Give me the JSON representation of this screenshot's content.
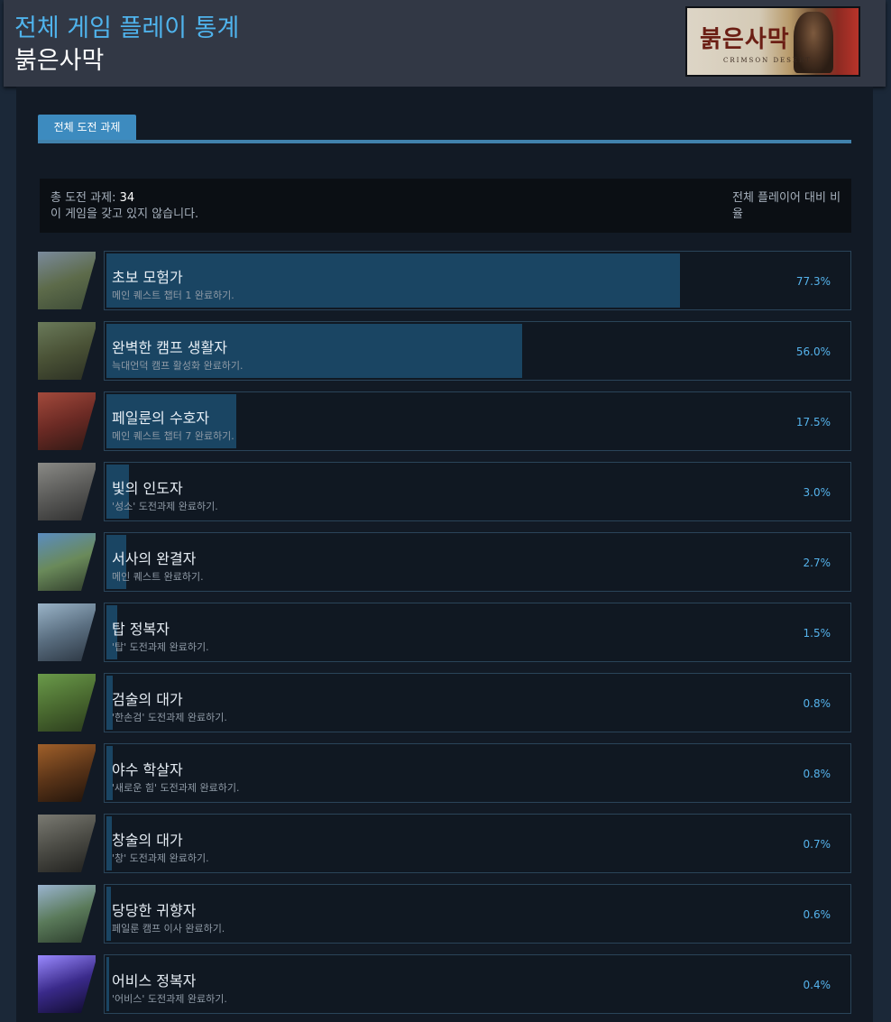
{
  "header": {
    "title": "전체 게임 플레이 통계",
    "game_name": "붉은사막",
    "capsule": {
      "title": "붉은사막",
      "subtitle": "CRIMSON DESERT"
    }
  },
  "tabs": [
    {
      "label": "전체 도전 과제",
      "active": true
    }
  ],
  "summary": {
    "total_label": "총 도전 과제: ",
    "total_count": "34",
    "ownership_note": "이 게임을 갖고 있지 않습니다.",
    "column_header": "전체 플레이어 대비 비율"
  },
  "colors": {
    "accent": "#4fb3ec",
    "tab": "#3d8bbf",
    "bar_fill": "#1a4563",
    "percent_text": "#55b3ec"
  },
  "achievements": [
    {
      "title": "초보 모험가",
      "description": "메인 퀘스트 챕터 1 완료하기.",
      "percent_label": "77.3%",
      "percent": 77.3,
      "icon": "landscape-castle-icon",
      "icon_colors": [
        "#7a8a9c",
        "#5d6b4a",
        "#3c4a36"
      ]
    },
    {
      "title": "완벽한 캠프 생활자",
      "description": "늑대언덕 캠프 활성화 완료하기.",
      "percent_label": "56.0%",
      "percent": 56.0,
      "icon": "camp-village-icon",
      "icon_colors": [
        "#6a7a5a",
        "#4a5236",
        "#2a2e22"
      ]
    },
    {
      "title": "페일룬의 수호자",
      "description": "메인 퀘스트 챕터 7 완료하기.",
      "percent_label": "17.5%",
      "percent": 17.5,
      "icon": "red-building-icon",
      "icon_colors": [
        "#a34a3c",
        "#6b2a24",
        "#2d1814"
      ]
    },
    {
      "title": "빛의 인도자",
      "description": "'성소' 도전과제 완료하기.",
      "percent_label": "3.0%",
      "percent": 3.0,
      "icon": "sanctum-ruins-icon",
      "icon_colors": [
        "#8a8a86",
        "#5a5a58",
        "#2e2e2e"
      ]
    },
    {
      "title": "서사의 완결자",
      "description": "메인 퀘스트 완료하기.",
      "percent_label": "2.7%",
      "percent": 2.7,
      "icon": "sky-city-icon",
      "icon_colors": [
        "#5a8cc0",
        "#6a8a5a",
        "#2e3a2a"
      ]
    },
    {
      "title": "탑 정복자",
      "description": "'탑' 도전과제 완료하기.",
      "percent_label": "1.5%",
      "percent": 1.5,
      "icon": "tower-machine-icon",
      "icon_colors": [
        "#9ab4c8",
        "#5a6e80",
        "#2a3440"
      ]
    },
    {
      "title": "검술의 대가",
      "description": "'한손검' 도전과제 완료하기.",
      "percent_label": "0.8%",
      "percent": 0.8,
      "icon": "swordsman-field-icon",
      "icon_colors": [
        "#6a9a4a",
        "#4a6a30",
        "#2a3a1c"
      ]
    },
    {
      "title": "야수 학살자",
      "description": "'새로운 힘' 도전과제 완료하기.",
      "percent_label": "0.8%",
      "percent": 0.8,
      "icon": "dark-cave-icon",
      "icon_colors": [
        "#a0602a",
        "#5a3418",
        "#1e120a"
      ]
    },
    {
      "title": "창술의 대가",
      "description": "'창' 도전과제 완료하기.",
      "percent_label": "0.7%",
      "percent": 0.7,
      "icon": "spear-warrior-icon",
      "icon_colors": [
        "#7a7a72",
        "#4a4a44",
        "#1e1e1c"
      ]
    },
    {
      "title": "당당한 귀향자",
      "description": "페일룬 캠프 이사 완료하기.",
      "percent_label": "0.6%",
      "percent": 0.6,
      "icon": "mountain-valley-icon",
      "icon_colors": [
        "#9ab4d0",
        "#5a7a5a",
        "#2a3a2a"
      ]
    },
    {
      "title": "어비스 정복자",
      "description": "'어비스' 도전과제 완료하기.",
      "percent_label": "0.4%",
      "percent": 0.4,
      "icon": "abyss-portal-icon",
      "icon_colors": [
        "#9a8aff",
        "#3a2a8a",
        "#0e0a2a"
      ]
    }
  ]
}
